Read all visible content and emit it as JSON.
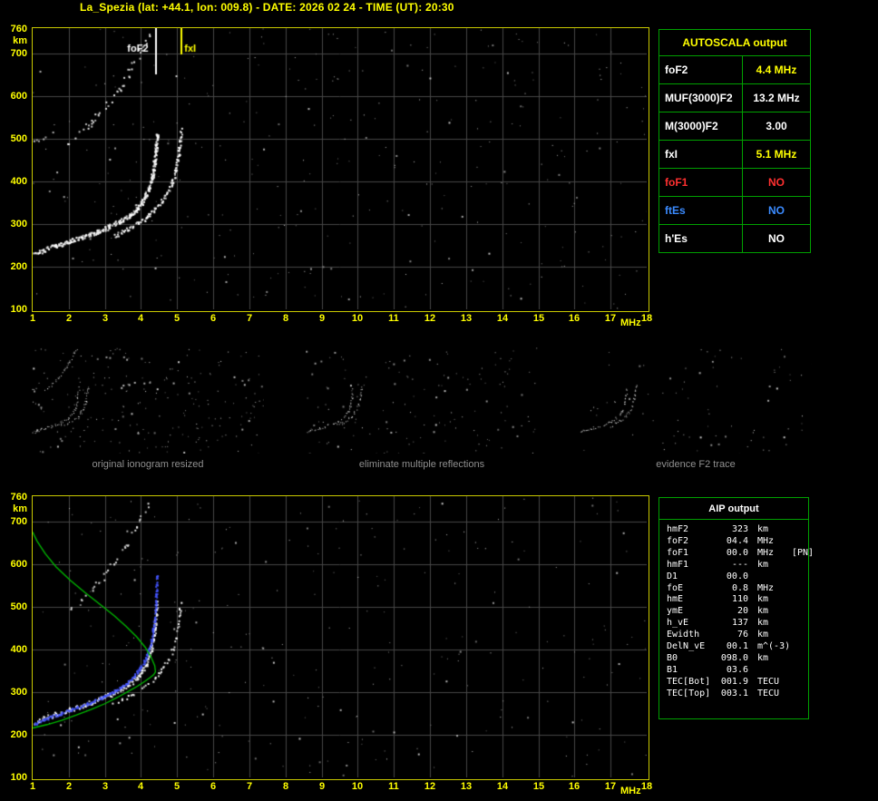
{
  "header": {
    "title": "La_Spezia (lat: +44.1, lon: 009.8) - DATE: 2026 02 24 - TIME (UT): 20:30"
  },
  "autoscala_table": {
    "title": "AUTOSCALA output",
    "rows": [
      {
        "param": "foF2",
        "value": "4.4 MHz",
        "param_color": "#ffffff",
        "value_color": "#ffff00"
      },
      {
        "param": "MUF(3000)F2",
        "value": "13.2 MHz",
        "param_color": "#ffffff",
        "value_color": "#ffffff"
      },
      {
        "param": "M(3000)F2",
        "value": "3.00",
        "param_color": "#ffffff",
        "value_color": "#ffffff"
      },
      {
        "param": "fxI",
        "value": "5.1 MHz",
        "param_color": "#ffffff",
        "value_color": "#ffff00"
      },
      {
        "param": "foF1",
        "value": "NO",
        "param_color": "#ff3030",
        "value_color": "#ff3030"
      },
      {
        "param": "ftEs",
        "value": "NO",
        "param_color": "#3b8bff",
        "value_color": "#3b8bff"
      },
      {
        "param": "h'Es",
        "value": "NO",
        "param_color": "#ffffff",
        "value_color": "#ffffff"
      }
    ]
  },
  "aip_table": {
    "title": "AIP output",
    "rows": [
      {
        "name": "hmF2",
        "value": "323",
        "unit": "km",
        "note": ""
      },
      {
        "name": "foF2",
        "value": "04.4",
        "unit": "MHz",
        "note": ""
      },
      {
        "name": "foF1",
        "value": "00.0",
        "unit": "MHz",
        "note": "[PN]"
      },
      {
        "name": "hmF1",
        "value": "---",
        "unit": "km",
        "note": ""
      },
      {
        "name": "D1",
        "value": "00.0",
        "unit": "",
        "note": ""
      },
      {
        "name": "foE",
        "value": "0.8",
        "unit": "MHz",
        "note": ""
      },
      {
        "name": "hmE",
        "value": "110",
        "unit": "km",
        "note": ""
      },
      {
        "name": "ymE",
        "value": "20",
        "unit": "km",
        "note": ""
      },
      {
        "name": "h_vE",
        "value": "137",
        "unit": "km",
        "note": ""
      },
      {
        "name": "Ewidth",
        "value": "76",
        "unit": "km",
        "note": ""
      },
      {
        "name": "DelN_vE",
        "value": "00.1",
        "unit": "m^(-3)",
        "note": ""
      },
      {
        "name": "B0",
        "value": "098.0",
        "unit": "km",
        "note": ""
      },
      {
        "name": "B1",
        "value": "03.6",
        "unit": "",
        "note": ""
      },
      {
        "name": "TEC[Bot]",
        "value": "001.9",
        "unit": "TECU",
        "note": ""
      },
      {
        "name": "TEC[Top]",
        "value": "003.1",
        "unit": "TECU",
        "note": ""
      }
    ]
  },
  "thumbnails": [
    {
      "caption": "original ionogram resized",
      "noise": {
        "count": 230,
        "seed": 31
      },
      "trace_names": [
        "f2_first_hop_o",
        "f2_first_hop_x",
        "f2_second_hop",
        "second_hop_left"
      ]
    },
    {
      "caption": "eliminate multiple reflections",
      "noise": {
        "count": 140,
        "seed": 32
      },
      "trace_names": [
        "f2_first_hop_o",
        "f2_first_hop_x"
      ]
    },
    {
      "caption": "evidence F2 trace",
      "noise": {
        "count": 80,
        "seed": 33
      },
      "trace_names": [
        "f2_first_hop_o",
        "f2_first_hop_x"
      ]
    }
  ],
  "chart_data": [
    {
      "id": "top_ionogram",
      "type": "scatter",
      "xlabel": "MHz",
      "ylabel": "km",
      "xlim": [
        1,
        18
      ],
      "ylim": [
        100,
        760
      ],
      "xticks": [
        1,
        2,
        3,
        4,
        5,
        6,
        7,
        8,
        9,
        10,
        11,
        12,
        13,
        14,
        15,
        16,
        17,
        18
      ],
      "yticks": [
        760,
        700,
        600,
        500,
        400,
        300,
        200,
        100
      ],
      "ygrid": [
        200,
        300,
        400,
        500,
        600,
        700
      ],
      "grid_color": "#474747",
      "noise": {
        "count": 320,
        "seed": 9
      },
      "traces": [
        {
          "name": "f2_first_hop_o",
          "color": "#ffffff",
          "dot": 2,
          "density": 3,
          "fill": 0.85,
          "jitter_x": 3,
          "jitter_y": 5,
          "points": [
            [
              1.05,
              232
            ],
            [
              1.3,
              240
            ],
            [
              1.6,
              249
            ],
            [
              2.0,
              260
            ],
            [
              2.4,
              271
            ],
            [
              2.8,
              283
            ],
            [
              3.1,
              294
            ],
            [
              3.4,
              307
            ],
            [
              3.65,
              320
            ],
            [
              3.85,
              334
            ],
            [
              4.0,
              350
            ],
            [
              4.12,
              368
            ],
            [
              4.22,
              390
            ],
            [
              4.3,
              415
            ],
            [
              4.36,
              445
            ],
            [
              4.4,
              478
            ],
            [
              4.43,
              512
            ]
          ]
        },
        {
          "name": "f2_first_hop_x",
          "color": "#ffffff",
          "dot": 2,
          "density": 2,
          "fill": 0.7,
          "jitter_x": 3,
          "jitter_y": 4,
          "points": [
            [
              3.2,
              272
            ],
            [
              3.6,
              288
            ],
            [
              3.9,
              303
            ],
            [
              4.15,
              318
            ],
            [
              4.38,
              336
            ],
            [
              4.58,
              356
            ],
            [
              4.74,
              378
            ],
            [
              4.86,
              402
            ],
            [
              4.95,
              430
            ],
            [
              5.02,
              462
            ],
            [
              5.07,
              495
            ],
            [
              5.1,
              522
            ]
          ]
        },
        {
          "name": "f2_second_hop",
          "color": "#e8e8e8",
          "dot": 2,
          "density": 1,
          "fill": 0.55,
          "jitter_x": 4,
          "jitter_y": 8,
          "points": [
            [
              1.95,
              492
            ],
            [
              2.2,
              510
            ],
            [
              2.5,
              532
            ],
            [
              2.8,
              556
            ],
            [
              3.05,
              582
            ],
            [
              3.3,
              610
            ],
            [
              3.55,
              642
            ],
            [
              3.75,
              672
            ],
            [
              3.95,
              705
            ],
            [
              4.12,
              732
            ],
            [
              4.28,
              756
            ]
          ]
        },
        {
          "name": "second_hop_left",
          "color": "#dddddd",
          "dot": 2,
          "density": 1,
          "fill": 0.5,
          "jitter_x": 3,
          "jitter_y": 3,
          "points": [
            [
              1.02,
              497
            ],
            [
              1.35,
              503
            ]
          ]
        }
      ],
      "markers": [
        {
          "label": "foF2-marker",
          "x": 4.4,
          "y1": 760,
          "y2": 652,
          "color": "#ffffff",
          "width": 2
        },
        {
          "label": "fxI-marker",
          "x": 5.1,
          "y1": 760,
          "y2": 698,
          "color": "#ffff00",
          "width": 2
        }
      ],
      "annotations": [
        {
          "text": "foF2",
          "x": 3.62,
          "y": 712,
          "color": "#ffffff"
        },
        {
          "text": "fxI",
          "x": 5.2,
          "y": 712,
          "color": "#ffff00"
        }
      ]
    },
    {
      "id": "bottom_ionogram",
      "type": "scatter",
      "xlabel": "MHz",
      "ylabel": "km",
      "xlim": [
        1,
        18
      ],
      "ylim": [
        100,
        760
      ],
      "xticks": [
        1,
        2,
        3,
        4,
        5,
        6,
        7,
        8,
        9,
        10,
        11,
        12,
        13,
        14,
        15,
        16,
        17,
        18
      ],
      "yticks": [
        760,
        700,
        600,
        500,
        400,
        300,
        200,
        100
      ],
      "ygrid": [
        200,
        300,
        400,
        500,
        600,
        700
      ],
      "grid_color": "#474747",
      "noise": {
        "count": 280,
        "seed": 17
      },
      "traces": [
        {
          "name": "f2_first_hop_o",
          "color": "#ffffff",
          "dot": 2,
          "density": 2,
          "fill": 0.75,
          "jitter_x": 3,
          "jitter_y": 5,
          "points": [
            [
              1.05,
              232
            ],
            [
              1.3,
              240
            ],
            [
              1.6,
              249
            ],
            [
              2.0,
              260
            ],
            [
              2.4,
              271
            ],
            [
              2.8,
              283
            ],
            [
              3.1,
              294
            ],
            [
              3.4,
              307
            ],
            [
              3.65,
              320
            ],
            [
              3.85,
              334
            ],
            [
              4.0,
              350
            ],
            [
              4.12,
              368
            ],
            [
              4.22,
              390
            ],
            [
              4.3,
              415
            ],
            [
              4.36,
              445
            ],
            [
              4.4,
              478
            ],
            [
              4.43,
              512
            ]
          ]
        },
        {
          "name": "f2_first_hop_x",
          "color": "#ffffff",
          "dot": 2,
          "density": 1,
          "fill": 0.6,
          "jitter_x": 3,
          "jitter_y": 4,
          "points": [
            [
              3.2,
              272
            ],
            [
              3.6,
              288
            ],
            [
              3.9,
              303
            ],
            [
              4.15,
              318
            ],
            [
              4.38,
              336
            ],
            [
              4.58,
              356
            ],
            [
              4.74,
              378
            ],
            [
              4.86,
              402
            ],
            [
              4.95,
              430
            ],
            [
              5.02,
              462
            ],
            [
              5.07,
              495
            ],
            [
              5.1,
              522
            ]
          ]
        },
        {
          "name": "f2_second_hop",
          "color": "#e8e8e8",
          "dot": 2,
          "density": 1,
          "fill": 0.5,
          "jitter_x": 4,
          "jitter_y": 8,
          "points": [
            [
              1.95,
              492
            ],
            [
              2.2,
              510
            ],
            [
              2.5,
              532
            ],
            [
              2.8,
              556
            ],
            [
              3.05,
              582
            ],
            [
              3.3,
              610
            ],
            [
              3.55,
              642
            ],
            [
              3.75,
              672
            ],
            [
              3.95,
              705
            ],
            [
              4.12,
              732
            ],
            [
              4.28,
              756
            ]
          ]
        },
        {
          "name": "restored_f2_trace",
          "color": "#4455ff",
          "dot": 2,
          "density": 2,
          "fill": 0.85,
          "jitter_x": 2,
          "jitter_y": 3,
          "points": [
            [
              1.05,
              228
            ],
            [
              1.4,
              240
            ],
            [
              1.8,
              252
            ],
            [
              2.2,
              264
            ],
            [
              2.6,
              277
            ],
            [
              3.0,
              292
            ],
            [
              3.3,
              306
            ],
            [
              3.6,
              322
            ],
            [
              3.8,
              338
            ],
            [
              3.95,
              355
            ],
            [
              4.08,
              374
            ],
            [
              4.18,
              396
            ],
            [
              4.27,
              422
            ],
            [
              4.33,
              452
            ],
            [
              4.38,
              488
            ],
            [
              4.41,
              530
            ],
            [
              4.43,
              575
            ]
          ]
        }
      ],
      "profile": {
        "name": "electron_density_profile",
        "color": "#00bb00",
        "points": [
          [
            1.0,
            216
          ],
          [
            1.4,
            224
          ],
          [
            1.8,
            234
          ],
          [
            2.2,
            246
          ],
          [
            2.6,
            259
          ],
          [
            3.0,
            273
          ],
          [
            3.35,
            288
          ],
          [
            3.65,
            302
          ],
          [
            3.9,
            314
          ],
          [
            4.1,
            325
          ],
          [
            4.25,
            334
          ],
          [
            4.35,
            341
          ],
          [
            4.4,
            348
          ],
          [
            4.38,
            362
          ],
          [
            4.28,
            382
          ],
          [
            4.12,
            405
          ],
          [
            3.88,
            430
          ],
          [
            3.58,
            455
          ],
          [
            3.25,
            480
          ],
          [
            2.85,
            507
          ],
          [
            2.45,
            534
          ],
          [
            2.05,
            562
          ],
          [
            1.65,
            594
          ],
          [
            1.35,
            625
          ],
          [
            1.12,
            655
          ],
          [
            1.0,
            676
          ]
        ]
      },
      "markers": [],
      "annotations": []
    }
  ]
}
